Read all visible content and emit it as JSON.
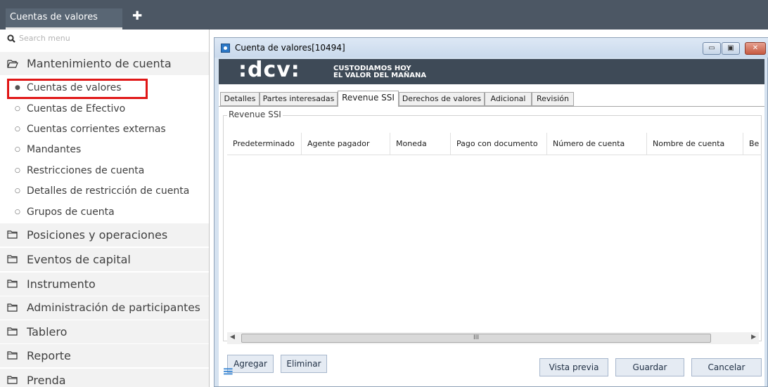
{
  "topbar": {
    "tab_label": "Cuentas de valores",
    "add_symbol": "✚"
  },
  "sidebar": {
    "search_placeholder": "Search menu",
    "sections": [
      {
        "label": "Mantenimiento de cuenta",
        "open": true
      },
      {
        "label": "Posiciones y operaciones"
      },
      {
        "label": "Eventos de capital"
      },
      {
        "label": "Instrumento"
      },
      {
        "label": "Administración de participantes"
      },
      {
        "label": "Tablero"
      },
      {
        "label": "Reporte"
      },
      {
        "label": "Prenda"
      }
    ],
    "items": [
      {
        "label": "Cuentas de valores",
        "selected": true
      },
      {
        "label": "Cuentas de Efectivo"
      },
      {
        "label": "Cuentas corrientes externas"
      },
      {
        "label": "Mandantes"
      },
      {
        "label": "Restricciones de cuenta"
      },
      {
        "label": "Detalles de restricción de cuenta"
      },
      {
        "label": "Grupos de cuenta"
      }
    ],
    "highlight_color": "#e01616"
  },
  "window": {
    "title": "Cuenta de valores[10494]",
    "min_symbol": "▭",
    "max_symbol": "▣",
    "close_symbol": "✕",
    "banner": {
      "logo": ":dcv:",
      "slogan_line1": "CUSTODIAMOS HOY",
      "slogan_line2": "EL VALOR DEL MAÑANA"
    },
    "tabs": [
      "Detalles",
      "Partes interesadas",
      "Revenue SSI",
      "Derechos de valores",
      "Adicional",
      "Revisión"
    ],
    "active_tab": "Revenue SSI",
    "group_label": "Revenue SSI",
    "columns": [
      "Predeterminado",
      "Agente pagador",
      "Moneda",
      "Pago con documento",
      "Número de cuenta",
      "Nombre de cuenta",
      "Be"
    ],
    "scroll_grip": "III",
    "buttons": {
      "add": "Agregar",
      "delete": "Eliminar"
    },
    "footer": {
      "menu_symbol": "≡",
      "preview": "Vista previa",
      "save": "Guardar",
      "cancel": "Cancelar"
    }
  }
}
